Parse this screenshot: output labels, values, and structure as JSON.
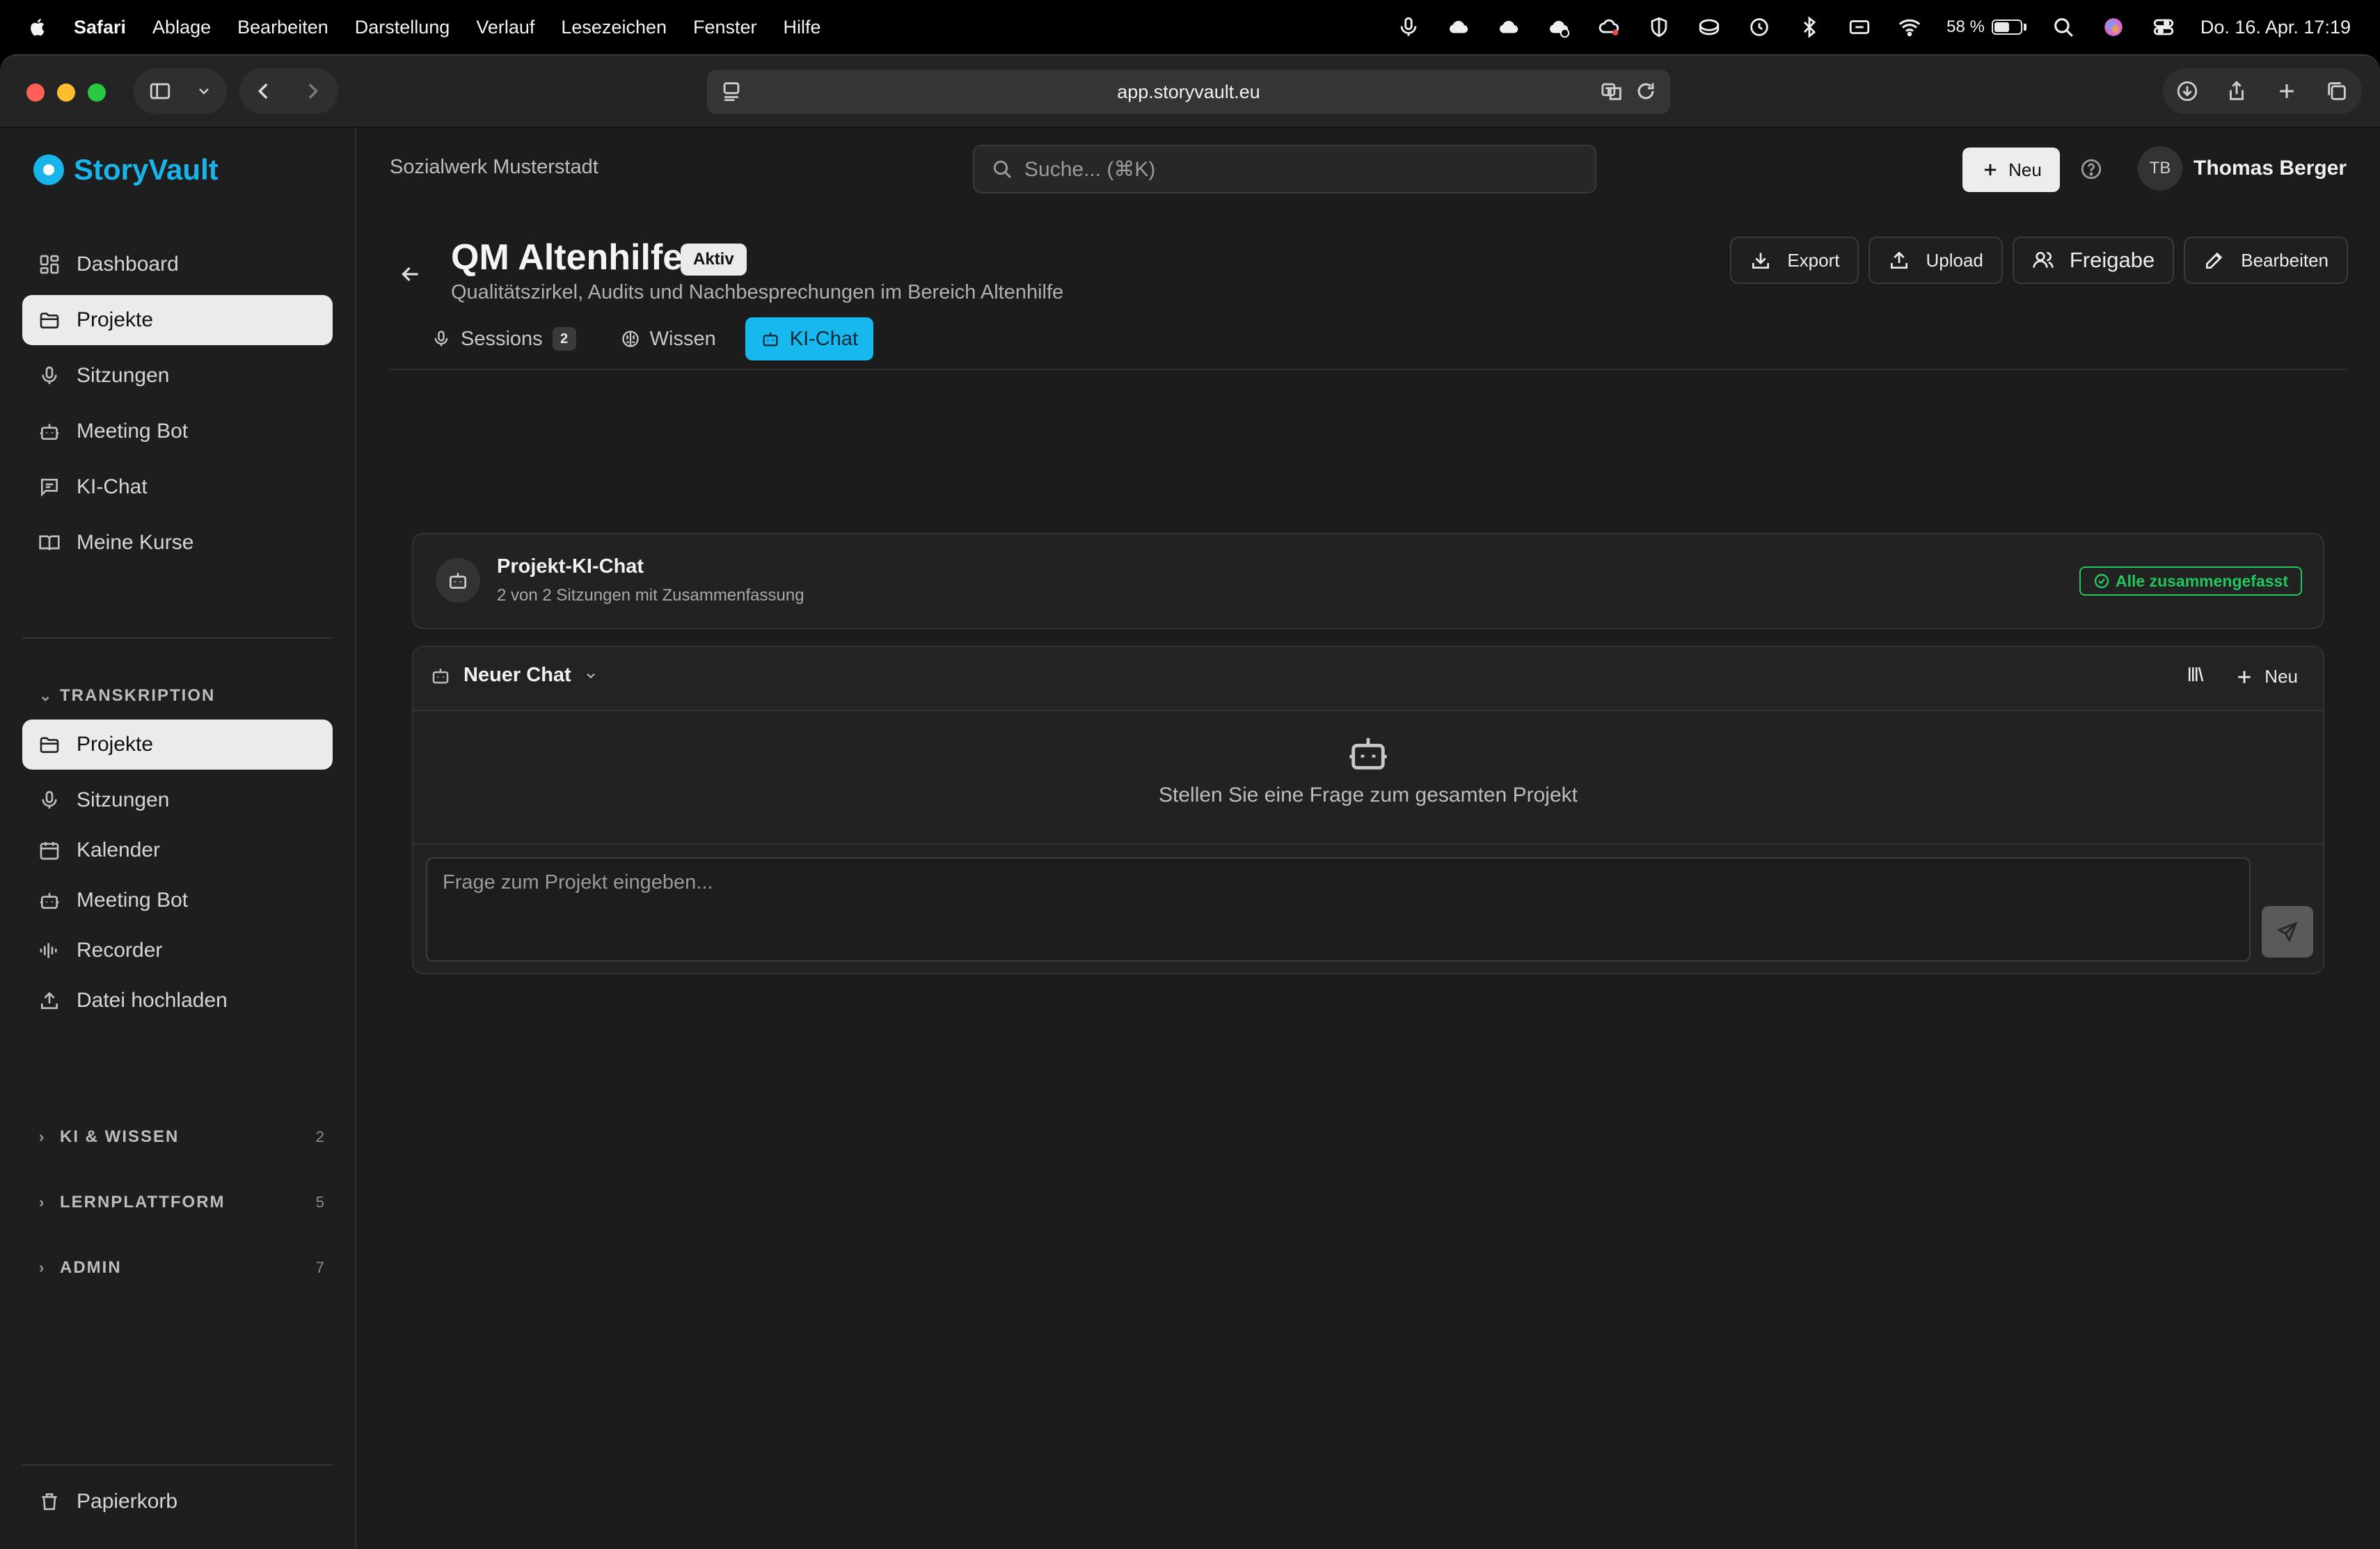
{
  "menubar": {
    "app_name": "Safari",
    "items": [
      "Ablage",
      "Bearbeiten",
      "Darstellung",
      "Verlauf",
      "Lesezeichen",
      "Fenster",
      "Hilfe"
    ],
    "battery_percent": "58 %",
    "battery_level": 0.58,
    "clock": "Do. 16. Apr.  17:19"
  },
  "browser": {
    "url": "app.storyvault.eu"
  },
  "brand": {
    "name": "StoryVault",
    "color": "#19b4ea"
  },
  "sidebar": {
    "main_items": [
      {
        "label": "Dashboard",
        "icon": "dashboard-icon"
      },
      {
        "label": "Projekte",
        "icon": "folder-icon",
        "active": true
      },
      {
        "label": "Sitzungen",
        "icon": "mic-icon"
      },
      {
        "label": "Meeting Bot",
        "icon": "bot-icon"
      },
      {
        "label": "KI-Chat",
        "icon": "chat-icon"
      },
      {
        "label": "Meine Kurse",
        "icon": "book-icon"
      }
    ],
    "transcription_label": "TRANSKRIPTION",
    "transcription_items": [
      {
        "label": "Projekte",
        "icon": "folder-icon",
        "active": true
      },
      {
        "label": "Sitzungen",
        "icon": "mic-icon"
      },
      {
        "label": "Kalender",
        "icon": "calendar-icon"
      },
      {
        "label": "Meeting Bot",
        "icon": "bot-icon"
      },
      {
        "label": "Recorder",
        "icon": "waveform-icon"
      },
      {
        "label": "Datei hochladen",
        "icon": "upload-icon"
      }
    ],
    "sections": [
      {
        "label": "KI & WISSEN",
        "count": "2"
      },
      {
        "label": "LERNPLATTFORM",
        "count": "5"
      },
      {
        "label": "ADMIN",
        "count": "7"
      }
    ],
    "trash_label": "Papierkorb"
  },
  "topbar": {
    "organization": "Sozialwerk Musterstadt",
    "search_placeholder": "Suche... (⌘K)",
    "new_label": "Neu",
    "user_initials": "TB",
    "user_name": "Thomas Berger"
  },
  "project": {
    "title": "QM Altenhilfe",
    "status": "Aktiv",
    "subtitle": "Qualitätszirkel, Audits und Nachbesprechungen im Bereich Altenhilfe",
    "actions": {
      "export": "Export",
      "upload": "Upload",
      "share": "Freigabe",
      "edit": "Bearbeiten"
    },
    "tabs": {
      "sessions": "Sessions",
      "sessions_count": "2",
      "knowledge": "Wissen",
      "chat": "KI-Chat"
    }
  },
  "chat_summary": {
    "title": "Projekt-KI-Chat",
    "subtitle": "2 von 2 Sitzungen mit Zusammenfassung",
    "status": "Alle zusammengefasst",
    "status_color": "#22c55e"
  },
  "chat": {
    "selector_label": "Neuer Chat",
    "new_label": "Neu",
    "empty_message": "Stellen Sie eine Frage zum gesamten Projekt",
    "input_placeholder": "Frage zum Projekt eingeben...",
    "accent_color": "#16b8ee"
  }
}
